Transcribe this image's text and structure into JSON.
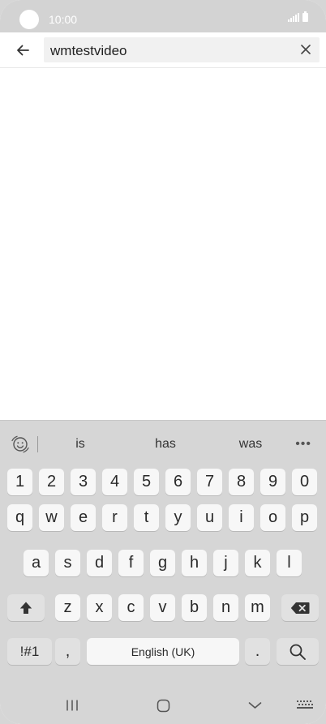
{
  "status_bar": {
    "time": "10:00"
  },
  "search": {
    "query": "wmtestvideo"
  },
  "keyboard": {
    "suggestions": [
      "is",
      "has",
      "was"
    ],
    "more": "•••",
    "row_numbers": [
      "1",
      "2",
      "3",
      "4",
      "5",
      "6",
      "7",
      "8",
      "9",
      "0"
    ],
    "row_1": [
      "q",
      "w",
      "e",
      "r",
      "t",
      "y",
      "u",
      "i",
      "o",
      "p"
    ],
    "row_2": [
      "a",
      "s",
      "d",
      "f",
      "g",
      "h",
      "j",
      "k",
      "l"
    ],
    "row_3": [
      "z",
      "x",
      "c",
      "v",
      "b",
      "n",
      "m"
    ],
    "symbols_key": "!#1",
    "comma_key": ",",
    "space_key": "English (UK)",
    "period_key": "."
  },
  "icons": {
    "back": "arrow-left-icon",
    "clear": "close-icon",
    "emoji": "emoji-icon",
    "shift": "shift-icon",
    "backspace": "backspace-icon",
    "search": "search-icon",
    "recents": "recents-icon",
    "home": "home-icon",
    "nav_back": "chevron-down-icon",
    "keyboard_switch": "keyboard-icon"
  }
}
